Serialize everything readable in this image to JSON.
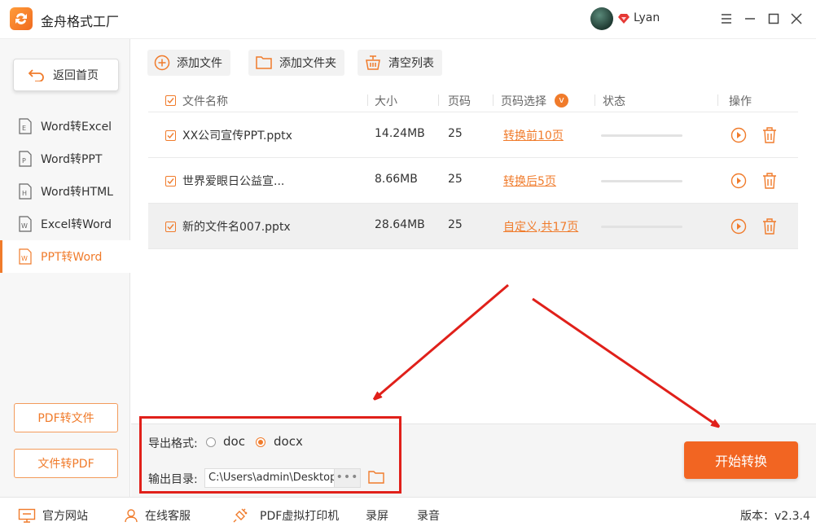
{
  "app": {
    "title": "金舟格式工厂",
    "username": "Lyan",
    "accent": "#f07b2b",
    "highlight": "#e0201a"
  },
  "window_controls": [
    "menu-icon",
    "minimize-icon",
    "maximize-icon",
    "close-icon"
  ],
  "sidebar": {
    "home_label": "返回首页",
    "items": [
      {
        "label": "Word转Excel",
        "active": false
      },
      {
        "label": "Word转PPT",
        "active": false
      },
      {
        "label": "Word转HTML",
        "active": false
      },
      {
        "label": "Excel转Word",
        "active": false
      },
      {
        "label": "PPT转Word",
        "active": true
      }
    ],
    "btn_pdf_to_file": "PDF转文件",
    "btn_file_to_pdf": "文件转PDF"
  },
  "toolbar": {
    "add_file": "添加文件",
    "add_folder": "添加文件夹",
    "clear_list": "清空列表"
  },
  "table": {
    "headers": {
      "name": "文件名称",
      "size": "大小",
      "pages": "页码",
      "page_select": "页码选择",
      "status": "状态",
      "ops": "操作"
    },
    "page_select_badge": "v",
    "rows": [
      {
        "name": "XX公司宣传PPT.pptx",
        "size": "14.24MB",
        "pages": "25",
        "page_select": "转换前10页",
        "progress": 0
      },
      {
        "name": "世界爱眼日公益宣...",
        "size": "8.66MB",
        "pages": "25",
        "page_select": "转换后5页",
        "progress": 0
      },
      {
        "name": "新的文件名007.pptx",
        "size": "28.64MB",
        "pages": "25",
        "page_select": "自定义,共17页",
        "progress": 0
      }
    ]
  },
  "settings": {
    "format_label": "导出格式:",
    "format_options": [
      "doc",
      "docx"
    ],
    "format_selected": "docx",
    "output_label": "输出目录:",
    "output_path": "C:\\Users\\admin\\Desktop",
    "browse_dots": "•••"
  },
  "start_button": "开始转换",
  "footer": {
    "website": "官方网站",
    "support": "在线客服",
    "pdf_printer": "PDF虚拟打印机",
    "screen_record": "录屏",
    "audio_record": "录音",
    "version": "版本：v2.3.4"
  }
}
